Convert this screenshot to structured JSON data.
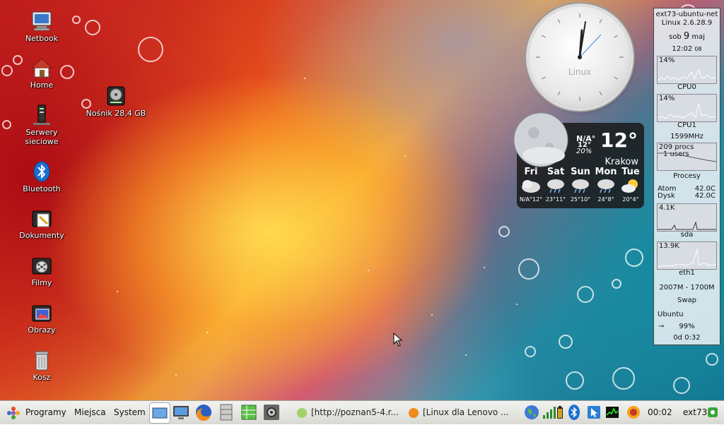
{
  "desktop": {
    "icons": [
      {
        "label": "Netbook"
      },
      {
        "label": "Home"
      },
      {
        "label": "Serwery sieciowe"
      },
      {
        "label": "Bluetooth"
      },
      {
        "label": "Dokumenty"
      },
      {
        "label": "Filmy"
      },
      {
        "label": "Obrazy"
      },
      {
        "label": "Kosz"
      },
      {
        "label": "Nośnik 28,4 GB"
      }
    ]
  },
  "clock": {
    "brand": "Linux"
  },
  "weather": {
    "current": {
      "now": "N/A°",
      "low": "12°",
      "chance": "20%",
      "temp": "12°"
    },
    "city": "Krakow",
    "days": [
      {
        "name": "Fri",
        "temps": "N/A°12°"
      },
      {
        "name": "Sat",
        "temps": "23°11°"
      },
      {
        "name": "Sun",
        "temps": "25°10°"
      },
      {
        "name": "Mon",
        "temps": "24°8°"
      },
      {
        "name": "Tue",
        "temps": "20°4°"
      }
    ]
  },
  "conky": {
    "hostname": "ext73-ubuntu-net",
    "kernel": "Linux 2.6.28.9",
    "date_day": "sob",
    "date_num": "9",
    "date_month": "maj",
    "time": "12:02",
    "time_suffix": "08",
    "cpu0_pct": "14%",
    "cpu0_label": "CPU0",
    "cpu1_pct": "14%",
    "cpu1_label": "CPU1",
    "freq": "1599MHz",
    "procs": "209 procs",
    "users": "1 users",
    "procs_label": "Procesy",
    "atom_label": "Atom",
    "atom_temp": "42.0C",
    "disk_label": "Dysk",
    "disk_temp": "42.0C",
    "sda_rate": "4.1K",
    "sda_label": "sda",
    "eth_rate": "13.9K",
    "eth_label": "eth1",
    "swap_values": "2007M - 1700M",
    "swap_label": "Swap",
    "fs_label": "Ubuntu",
    "battery": "99%",
    "uptime": "0d  0:32"
  },
  "panel": {
    "menus": [
      {
        "label": "Programy"
      },
      {
        "label": "Miejsca"
      },
      {
        "label": "System"
      }
    ],
    "tasks": [
      {
        "label": "[http://poznan5-4.r..."
      },
      {
        "label": "[Linux dla Lenovo ..."
      }
    ],
    "clock": "00:02",
    "user": "ext73"
  },
  "colors": {
    "panel_bg": "#e6e6e2",
    "conky_bg": "#ebf0f5",
    "weather_bg": "#1e1e1e"
  }
}
